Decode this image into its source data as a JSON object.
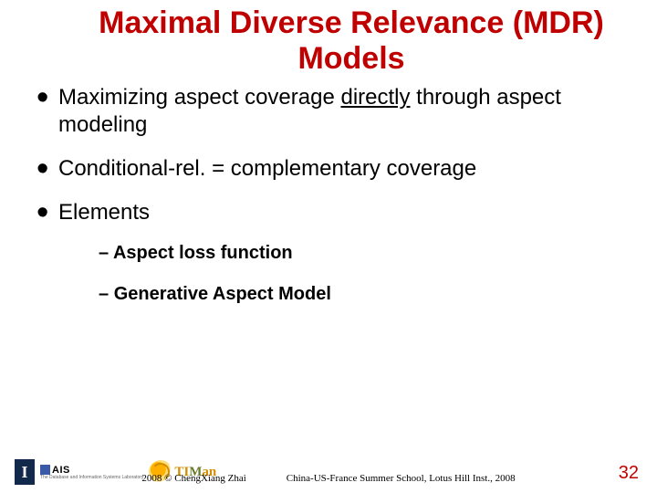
{
  "title": "Maximal Diverse Relevance (MDR) Models",
  "bullets": [
    {
      "pre": "Maximizing aspect coverage ",
      "underline": "directly",
      "post": " through aspect modeling"
    },
    {
      "pre": "Conditional-rel. = complementary coverage",
      "underline": "",
      "post": ""
    },
    {
      "pre": "Elements",
      "underline": "",
      "post": ""
    }
  ],
  "sub_items": [
    "Aspect loss function",
    "Generative Aspect Model"
  ],
  "logos": {
    "illinois_letter": "I",
    "dais": "AIS",
    "dais_sub": "The Database and Information Systems Laboratory",
    "timan_ti": "TI",
    "timan_m": "M",
    "timan_an": "an"
  },
  "footer": {
    "copyright": "2008 © ChengXiang Zhai",
    "venue": "China-US-France Summer School, Lotus Hill Inst., 2008"
  },
  "page_number": "32"
}
